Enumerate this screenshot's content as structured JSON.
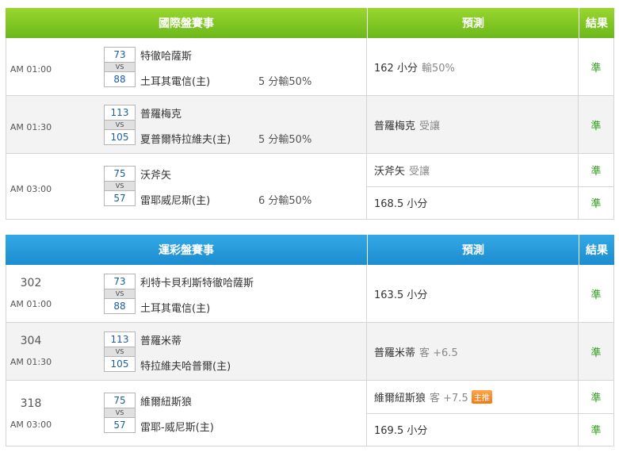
{
  "tables": [
    {
      "header": {
        "event": "國際盤賽事",
        "prediction": "預測",
        "result": "結果"
      },
      "rows": [
        {
          "time": "AM 01:00",
          "away": "特徹哈薩斯",
          "away_score": "73",
          "vs": "VS",
          "home": "土耳其電信(主)",
          "home_score": "88",
          "handicap": "5 分輸50%",
          "picks": [
            {
              "pick": "162 小分",
              "note": "輸50%",
              "result": "準"
            }
          ]
        },
        {
          "time": "AM 01:30",
          "away": "普羅梅克",
          "away_score": "113",
          "vs": "VS",
          "home": "夏普爾特拉維夫(主)",
          "home_score": "105",
          "handicap": "5 分輸50%",
          "picks": [
            {
              "pick": "普羅梅克",
              "note": "受讓",
              "result": "準"
            }
          ]
        },
        {
          "time": "AM 03:00",
          "away": "沃斧矢",
          "away_score": "75",
          "vs": "VS",
          "home": "雷耶威尼斯(主)",
          "home_score": "57",
          "handicap": "6 分輸50%",
          "picks": [
            {
              "pick": "沃斧矢",
              "note": "受讓",
              "result": "準"
            },
            {
              "pick": "168.5 小分",
              "note": "",
              "result": "準"
            }
          ]
        }
      ]
    },
    {
      "header": {
        "event": "運彩盤賽事",
        "prediction": "預測",
        "result": "結果"
      },
      "rows": [
        {
          "game_no": "302",
          "time": "AM 01:00",
          "away": "利特卡貝利斯特徹哈薩斯",
          "away_score": "73",
          "vs": "VS",
          "home": "土耳其電信(主)",
          "home_score": "88",
          "picks": [
            {
              "pick": "163.5 小分",
              "note": "",
              "result": "準"
            }
          ]
        },
        {
          "game_no": "304",
          "time": "AM 01:30",
          "away": "普羅米蒂",
          "away_score": "113",
          "vs": "VS",
          "home": "特拉維夫哈普爾(主)",
          "home_score": "105",
          "picks": [
            {
              "pick": "普羅米蒂",
              "note": "客 +6.5",
              "result": "準"
            }
          ]
        },
        {
          "game_no": "318",
          "time": "AM 03:00",
          "away": "維爾紐斯狼",
          "away_score": "75",
          "vs": "VS",
          "home": "雷耶-威尼斯(主)",
          "home_score": "57",
          "picks": [
            {
              "pick": "維爾紐斯狼",
              "note": "客 +7.5",
              "badge": "主推",
              "result": "準"
            },
            {
              "pick": "169.5 小分",
              "note": "",
              "result": "準"
            }
          ]
        }
      ]
    }
  ],
  "colors": {
    "intl_header": "#7cc424",
    "sports_header": "#2a9fe0",
    "result_text": "#2e9a1c",
    "score_text": "#1a5f9b",
    "badge": "#f48a25"
  }
}
